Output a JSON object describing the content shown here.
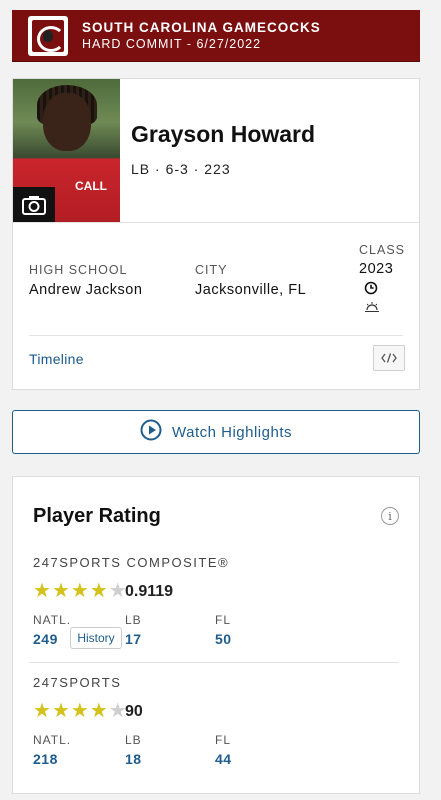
{
  "commit": {
    "team": "SOUTH CAROLINA GAMECOCKS",
    "status": "HARD COMMIT - 6/27/2022"
  },
  "player": {
    "name": "Grayson Howard",
    "meta": "LB · 6-3 · 223",
    "photo_jersey_text": "CALL",
    "high_school_label": "HIGH SCHOOL",
    "high_school": "Andrew Jackson",
    "city_label": "CITY",
    "city": "Jacksonville, FL",
    "class_label": "CLASS",
    "class_year": "2023",
    "timeline_label": "Timeline"
  },
  "highlights": {
    "label": "Watch Highlights"
  },
  "rating": {
    "title": "Player Rating",
    "composite": {
      "label": "247SPORTS COMPOSITE®",
      "stars": 4,
      "score": "0.9119",
      "natl_label": "NATL.",
      "natl": "249",
      "history_label": "History",
      "pos_label": "LB",
      "pos": "17",
      "state_label": "FL",
      "state": "50"
    },
    "sports247": {
      "label": "247SPORTS",
      "stars": 4,
      "score": "90",
      "natl_label": "NATL.",
      "natl": "218",
      "pos_label": "LB",
      "pos": "18",
      "state_label": "FL",
      "state": "44"
    }
  },
  "colors": {
    "banner": "#7b0f0f",
    "link": "#1f5d8c",
    "star": "#d4c21a"
  }
}
